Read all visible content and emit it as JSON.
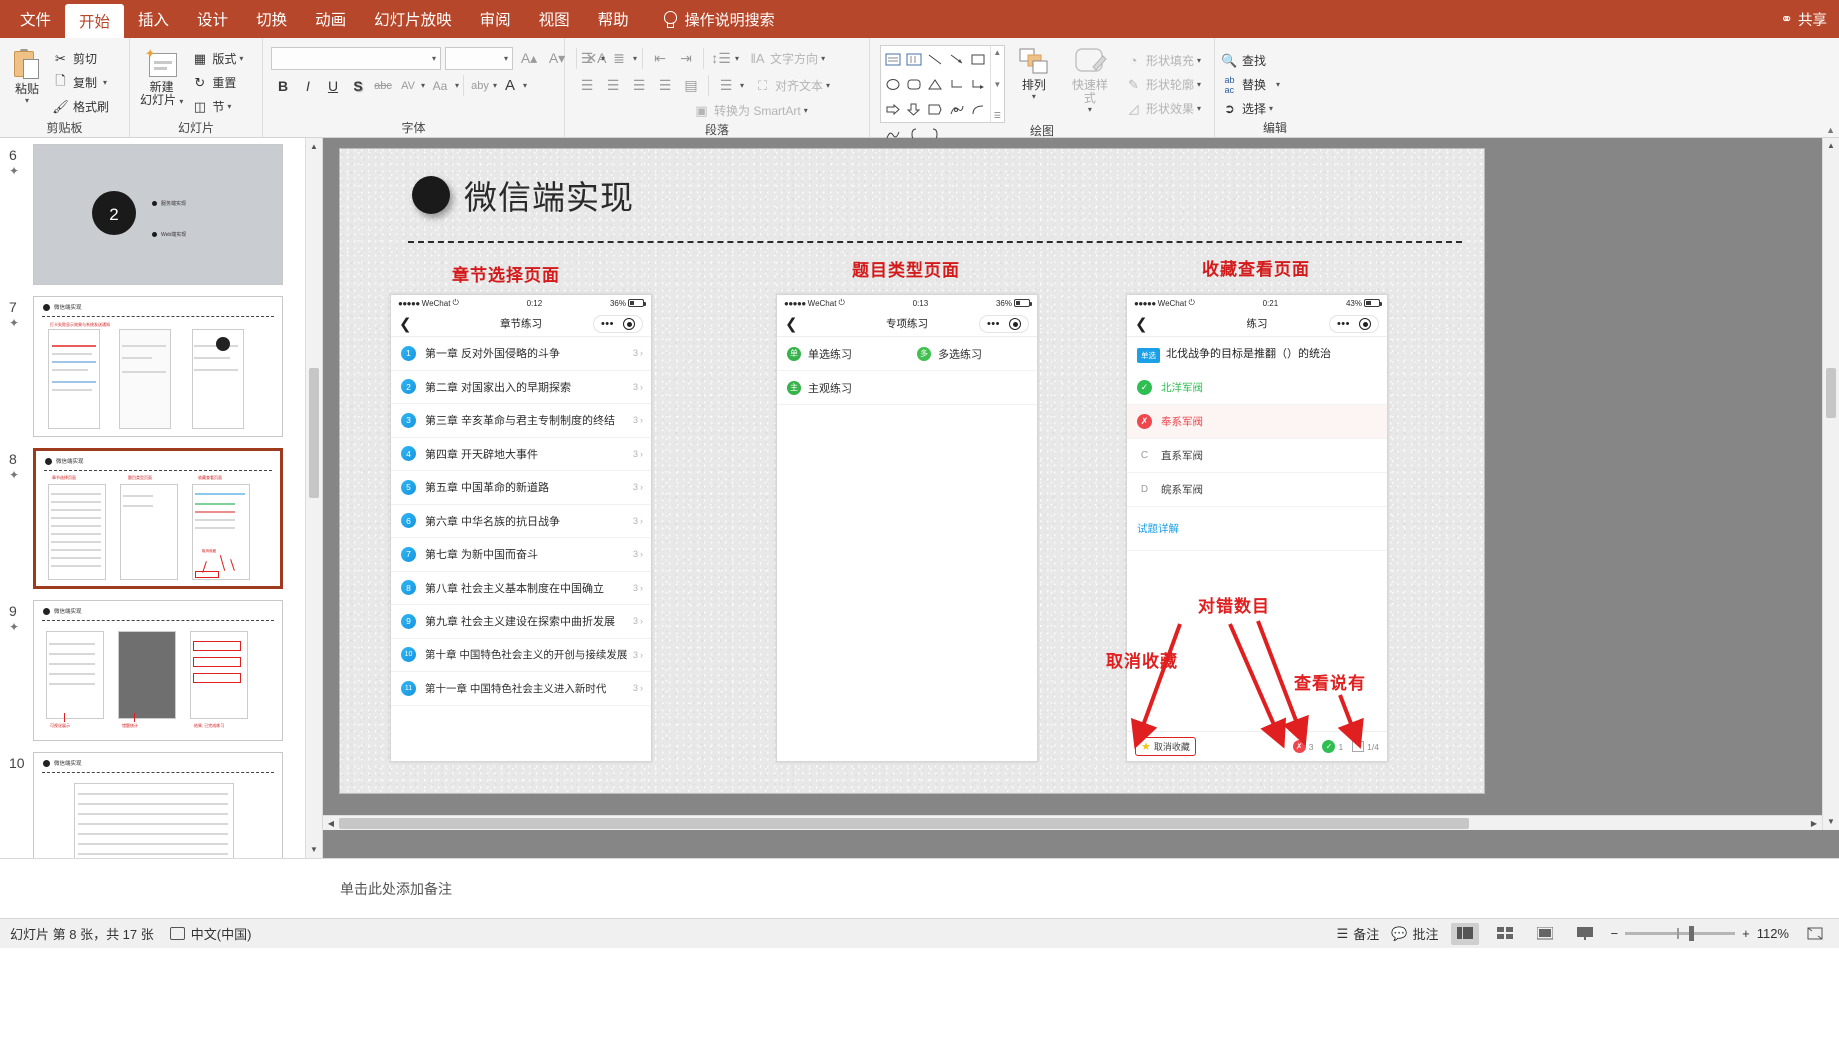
{
  "ribbon_tabs": [
    {
      "label": "文件",
      "active": false
    },
    {
      "label": "开始",
      "active": true
    },
    {
      "label": "插入",
      "active": false
    },
    {
      "label": "设计",
      "active": false
    },
    {
      "label": "切换",
      "active": false
    },
    {
      "label": "动画",
      "active": false
    },
    {
      "label": "幻灯片放映",
      "active": false
    },
    {
      "label": "审阅",
      "active": false
    },
    {
      "label": "视图",
      "active": false
    },
    {
      "label": "帮助",
      "active": false
    }
  ],
  "tellme": "操作说明搜索",
  "share": "共享",
  "groups": {
    "clipboard": {
      "title": "剪贴板",
      "paste": "粘贴",
      "cut": "剪切",
      "copy": "复制",
      "format_painter": "格式刷"
    },
    "slides": {
      "title": "幻灯片",
      "new_slide": "新建\n幻灯片",
      "new_slide_l1": "新建",
      "new_slide_l2": "幻灯片",
      "layout": "版式",
      "reset": "重置",
      "section": "节"
    },
    "font": {
      "title": "字体",
      "font_name": "",
      "font_size": "",
      "bold": "B",
      "italic": "I",
      "underline": "U",
      "shadow": "S",
      "strike": "abc",
      "spacing": "AV",
      "case": "Aa",
      "grow": "A",
      "shrink": "A",
      "clear": "A",
      "highlight": "aby",
      "color": "A"
    },
    "paragraph": {
      "title": "段落",
      "text_direction": "文字方向",
      "align_text": "对齐文本",
      "smartart": "转换为 SmartArt"
    },
    "drawing": {
      "title": "绘图",
      "arrange": "排列",
      "quick_styles": "快速样式",
      "shape_fill": "形状填充",
      "shape_outline": "形状轮廓",
      "shape_effects": "形状效果"
    },
    "editing": {
      "title": "编辑",
      "find": "查找",
      "replace": "替换",
      "select": "选择"
    }
  },
  "thumbnails": [
    {
      "number": "6",
      "starred": true,
      "selected": false
    },
    {
      "number": "7",
      "starred": true,
      "selected": false
    },
    {
      "number": "8",
      "starred": true,
      "selected": true
    },
    {
      "number": "9",
      "starred": true,
      "selected": false
    },
    {
      "number": "10",
      "starred": false,
      "selected": false
    }
  ],
  "slide": {
    "title": "微信端实现",
    "section_labels": [
      "章节选择页面",
      "题目类型页面",
      "收藏查看页面"
    ],
    "phone1": {
      "status": {
        "carrier": "WeChat",
        "time": "0:12",
        "battery": "36%"
      },
      "nav_title": "章节练习",
      "chapters": [
        {
          "num": "1",
          "name": "第一章 反对外国侵略的斗争",
          "count": "3"
        },
        {
          "num": "2",
          "name": "第二章 对国家出入的早期探索",
          "count": "3"
        },
        {
          "num": "3",
          "name": "第三章 辛亥革命与君主专制制度的终结",
          "count": "3"
        },
        {
          "num": "4",
          "name": "第四章 开天辟地大事件",
          "count": "3"
        },
        {
          "num": "5",
          "name": "第五章 中国革命的新道路",
          "count": "3"
        },
        {
          "num": "6",
          "name": "第六章 中华名族的抗日战争",
          "count": "3"
        },
        {
          "num": "7",
          "name": "第七章 为新中国而奋斗",
          "count": "3"
        },
        {
          "num": "8",
          "name": "第八章 社会主义基本制度在中国确立",
          "count": "3"
        },
        {
          "num": "9",
          "name": "第九章 社会主义建设在探索中曲折发展",
          "count": "3"
        },
        {
          "num": "10",
          "name": "第十章 中国特色社会主义的开创与接续发展",
          "count": "3"
        },
        {
          "num": "11",
          "name": "第十一章 中国特色社会主义进入新时代",
          "count": "3"
        }
      ]
    },
    "phone2": {
      "status": {
        "carrier": "WeChat",
        "time": "0:13",
        "battery": "36%"
      },
      "nav_title": "专项练习",
      "types": [
        {
          "badge": "单",
          "label": "单选练习"
        },
        {
          "badge": "多",
          "label": "多选练习"
        },
        {
          "badge": "主",
          "label": "主观练习"
        }
      ]
    },
    "phone3": {
      "status": {
        "carrier": "WeChat",
        "time": "0:21",
        "battery": "43%"
      },
      "nav_title": "练习",
      "question_tag": "单选",
      "question": "北伐战争的目标是推翻（）的统治",
      "options": [
        {
          "mark": "ok",
          "letter": "",
          "text": "北洋军阀"
        },
        {
          "mark": "no",
          "letter": "",
          "text": "奉系军阀"
        },
        {
          "mark": "plain",
          "letter": "C",
          "text": "直系军阀"
        },
        {
          "mark": "plain",
          "letter": "D",
          "text": "皖系军阀"
        }
      ],
      "detail_link": "试题详解",
      "favorite_label": "取消收藏",
      "stat_wrong": "3",
      "stat_right": "1",
      "stat_page": "1/4"
    },
    "annotations": [
      {
        "text": "对错数目"
      },
      {
        "text": "取消收藏"
      },
      {
        "text": "查看说有"
      }
    ]
  },
  "notes_placeholder": "单击此处添加备注",
  "statusbar": {
    "slide_info": "幻灯片 第 8 张，共 17 张",
    "language": "中文(中国)",
    "notes": "备注",
    "comments": "批注",
    "zoom": "112%"
  }
}
